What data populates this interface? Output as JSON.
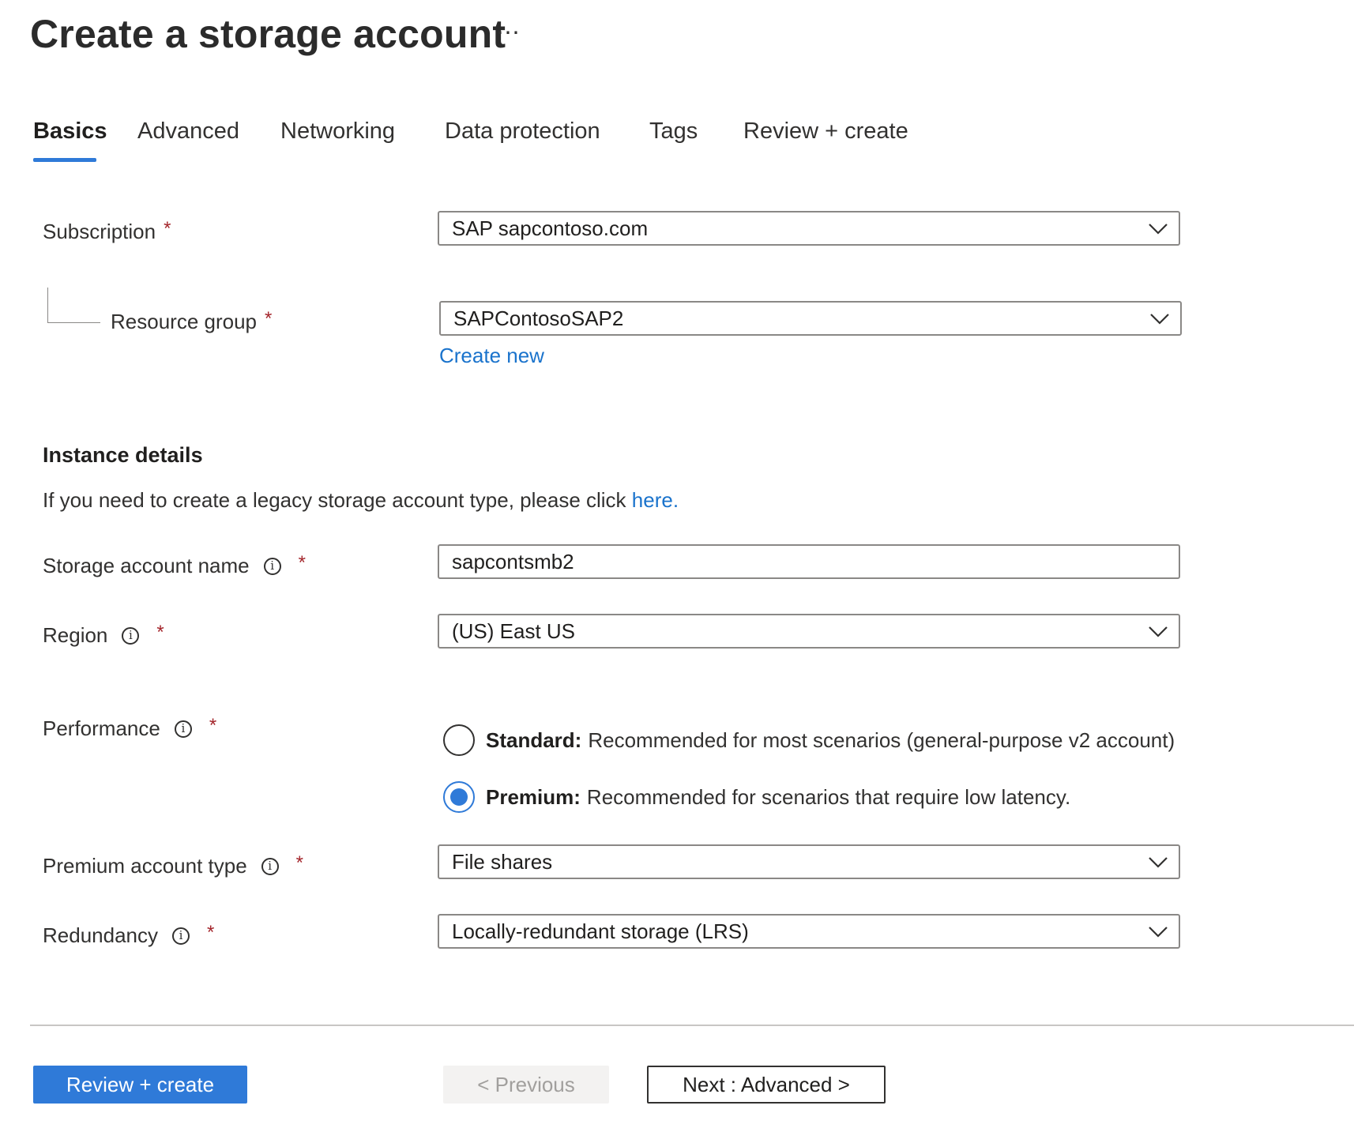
{
  "header": {
    "title": "Create a storage account",
    "more_label": "⋯"
  },
  "tabs": [
    {
      "label": "Basics",
      "active": true
    },
    {
      "label": "Advanced",
      "active": false
    },
    {
      "label": "Networking",
      "active": false
    },
    {
      "label": "Data protection",
      "active": false
    },
    {
      "label": "Tags",
      "active": false
    },
    {
      "label": "Review + create",
      "active": false
    }
  ],
  "project": {
    "subscription": {
      "label": "Subscription",
      "required": "*",
      "value": "SAP sapcontoso.com"
    },
    "resource_group": {
      "label": "Resource group",
      "required": "*",
      "value": "SAPContosoSAP2",
      "create_new": "Create new"
    }
  },
  "instance": {
    "heading": "Instance details",
    "note_text": "If you need to create a legacy storage account type, please click ",
    "note_link": "here.",
    "storage_account_name": {
      "label": "Storage account name",
      "required": "*",
      "value": "sapcontsmb2"
    },
    "region": {
      "label": "Region",
      "required": "*",
      "value": "(US) East US"
    },
    "performance": {
      "label": "Performance",
      "required": "*",
      "options": [
        {
          "name": "Standard:",
          "description": "Recommended for most scenarios (general-purpose v2 account)",
          "checked": false
        },
        {
          "name": "Premium:",
          "description": "Recommended for scenarios that require low latency.",
          "checked": true
        }
      ]
    },
    "premium_account_type": {
      "label": "Premium account type",
      "required": "*",
      "value": "File shares"
    },
    "redundancy": {
      "label": "Redundancy",
      "required": "*",
      "value": "Locally-redundant storage (LRS)"
    }
  },
  "footer": {
    "review_create": "Review + create",
    "previous": "< Previous",
    "next": "Next : Advanced >"
  },
  "colors": {
    "accent": "#2f7ad8",
    "link": "#1a73cc",
    "required": "#a4262c"
  },
  "icons": {
    "info": "info-circle-icon",
    "dropdown": "chevron-down-icon"
  }
}
